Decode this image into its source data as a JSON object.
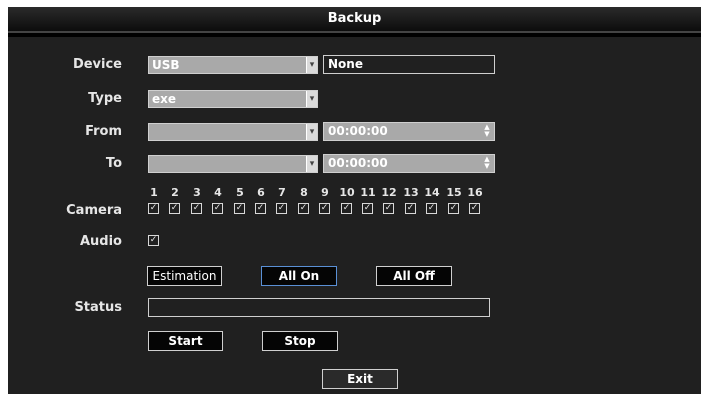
{
  "window": {
    "title": "Backup"
  },
  "labels": {
    "device": "Device",
    "type": "Type",
    "from": "From",
    "to": "To",
    "camera": "Camera",
    "audio": "Audio",
    "status": "Status"
  },
  "device": {
    "value": "USB",
    "target": "None"
  },
  "type": {
    "value": "exe"
  },
  "from": {
    "date": "",
    "time": "00:00:00"
  },
  "to": {
    "date": "",
    "time": "00:00:00"
  },
  "camera": {
    "channels": [
      "1",
      "2",
      "3",
      "4",
      "5",
      "6",
      "7",
      "8",
      "9",
      "10",
      "11",
      "12",
      "13",
      "14",
      "15",
      "16"
    ],
    "checked": [
      true,
      true,
      true,
      true,
      true,
      true,
      true,
      true,
      true,
      true,
      true,
      true,
      true,
      true,
      true,
      true
    ]
  },
  "audio": {
    "checked": true
  },
  "status": {
    "value": ""
  },
  "buttons": {
    "estimation": "Estimation",
    "all_on": "All On",
    "all_off": "All Off",
    "start": "Start",
    "stop": "Stop",
    "exit": "Exit"
  },
  "icons": {
    "dropdown": "chevron-down-icon",
    "spinner": "up-down-spinner-icon",
    "check": "checkmark-icon"
  }
}
